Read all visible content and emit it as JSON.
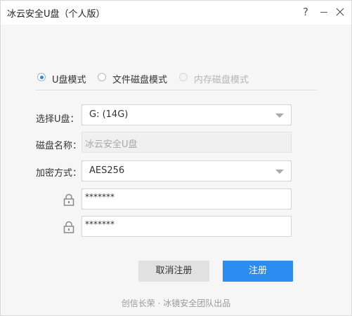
{
  "window": {
    "title": "冰云安全U盘（个人版）",
    "help_icon": "question-mark-icon",
    "minimize_icon": "minimize-icon",
    "close_icon": "close-icon"
  },
  "modes": [
    {
      "label": "U盘模式",
      "state": "selected"
    },
    {
      "label": "文件磁盘模式",
      "state": "unselected"
    },
    {
      "label": "内存磁盘模式",
      "state": "disabled"
    }
  ],
  "form": {
    "select_drive": {
      "label": "选择U盘：",
      "value": "G: (14G)"
    },
    "disk_name": {
      "label": "磁盘名称：",
      "placeholder": "冰云安全U盘"
    },
    "encryption": {
      "label": "加密方式：",
      "value": "AES256"
    },
    "password": {
      "value": "*******"
    },
    "confirm_password": {
      "value": "*******"
    }
  },
  "buttons": {
    "cancel": "取消注册",
    "register": "注册"
  },
  "footer": "创信长荣 · 冰镜安全团队出品",
  "colors": {
    "accent": "#2d8cf0",
    "window_bg": "#f6f6f6",
    "disabled_text": "#b5b5b5"
  }
}
